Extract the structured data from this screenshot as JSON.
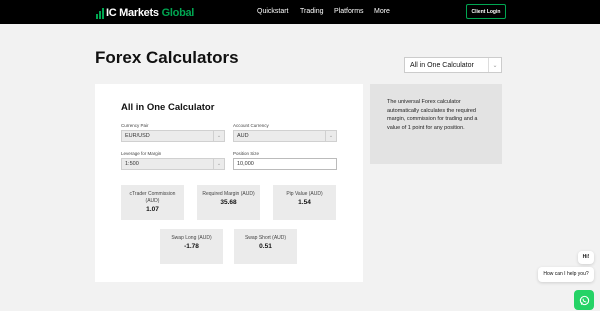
{
  "nav": {
    "logo_part1": "IC Markets",
    "logo_part2": "Global",
    "links": [
      "Quickstart",
      "Trading",
      "Platforms",
      "More"
    ],
    "login_label": "Client Login"
  },
  "page": {
    "title": "Forex Calculators",
    "calculator_select": "All in One Calculator"
  },
  "card": {
    "title": "All in One Calculator",
    "currency_pair": {
      "label": "Currency Pair",
      "value": "EUR/USD"
    },
    "account_currency": {
      "label": "Account Currency",
      "value": "AUD"
    },
    "leverage": {
      "label": "Leverage for Margin",
      "value": "1:500"
    },
    "position_size": {
      "label": "Position Size",
      "value": "10,000"
    },
    "results": [
      {
        "label": "cTrader Commission (AUD)",
        "value": "1.07"
      },
      {
        "label": "Required Margin (AUD)",
        "value": "35.68"
      },
      {
        "label": "Pip Value (AUD)",
        "value": "1.54"
      },
      {
        "label": "Swap Long (AUD)",
        "value": "-1.78"
      },
      {
        "label": "Swap Short (AUD)",
        "value": "0.51"
      }
    ]
  },
  "info": {
    "text": "The universal Forex calculator automatically calculates the required margin, commission for trading and a value of 1 point for any position."
  },
  "chat": {
    "greeting": "Hi!",
    "prompt": "How can I help you?"
  },
  "colors": {
    "brand_green": "#00a651",
    "whatsapp_green": "#25d366"
  }
}
